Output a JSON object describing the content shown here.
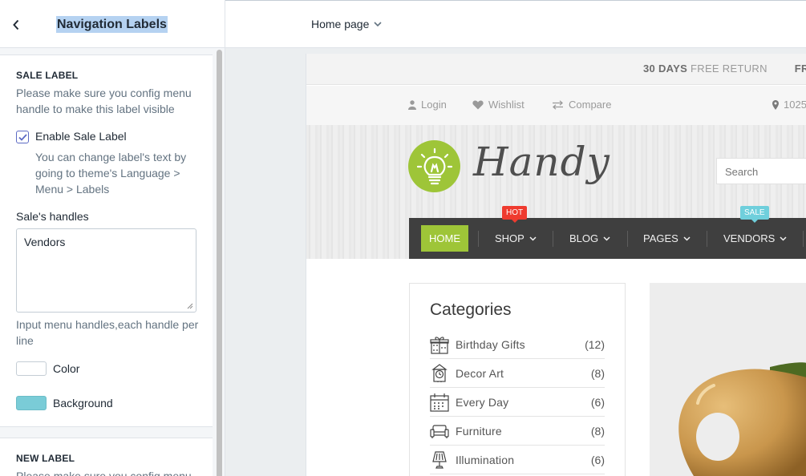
{
  "sidebar": {
    "title": "Navigation Labels",
    "sale_section": {
      "heading": "SALE LABEL",
      "help": "Please make sure you config menu handle to make this label visible",
      "enable_label": "Enable Sale Label",
      "enable_checked": true,
      "enable_help": "You can change label's text by going to theme's Language > Menu > Labels",
      "handles_label": "Sale's handles",
      "handles_value": "Vendors",
      "handles_help": "Input menu handles,each handle per line",
      "color_label": "Color",
      "color_value": "#ffffff",
      "background_label": "Background",
      "background_value": "#7accd7"
    },
    "new_section": {
      "heading": "NEW LABEL",
      "help": "Please make sure you config menu"
    }
  },
  "topbar": {
    "page_selector": "Home page"
  },
  "preview": {
    "promo": {
      "bold": "30 DAYS",
      "text": " FREE RETURN",
      "next": "FREE"
    },
    "top_links": {
      "login": "Login",
      "wishlist": "Wishlist",
      "compare": "Compare",
      "address": "1025"
    },
    "logo_text": "Handy",
    "search_placeholder": "Search",
    "menu": {
      "home": "HOME",
      "shop": "SHOP",
      "blog": "BLOG",
      "pages": "PAGES",
      "vendors": "VENDORS",
      "hot_tag": "HOT",
      "sale_tag": "SALE"
    },
    "categories": {
      "title": "Categories",
      "items": [
        {
          "name": "Birthday Gifts",
          "count": "(12)",
          "icon": "gift-icon"
        },
        {
          "name": "Decor Art",
          "count": "(8)",
          "icon": "clock-icon"
        },
        {
          "name": "Every Day",
          "count": "(6)",
          "icon": "calendar-icon"
        },
        {
          "name": "Furniture",
          "count": "(8)",
          "icon": "sofa-icon"
        },
        {
          "name": "Illumination",
          "count": "(6)",
          "icon": "lamp-icon"
        }
      ]
    },
    "colors": {
      "accent_green": "#9ec538",
      "hot_red": "#ef3b2f",
      "sale_blue": "#6fcfdc",
      "menu_dark": "#3f3f3f"
    }
  }
}
